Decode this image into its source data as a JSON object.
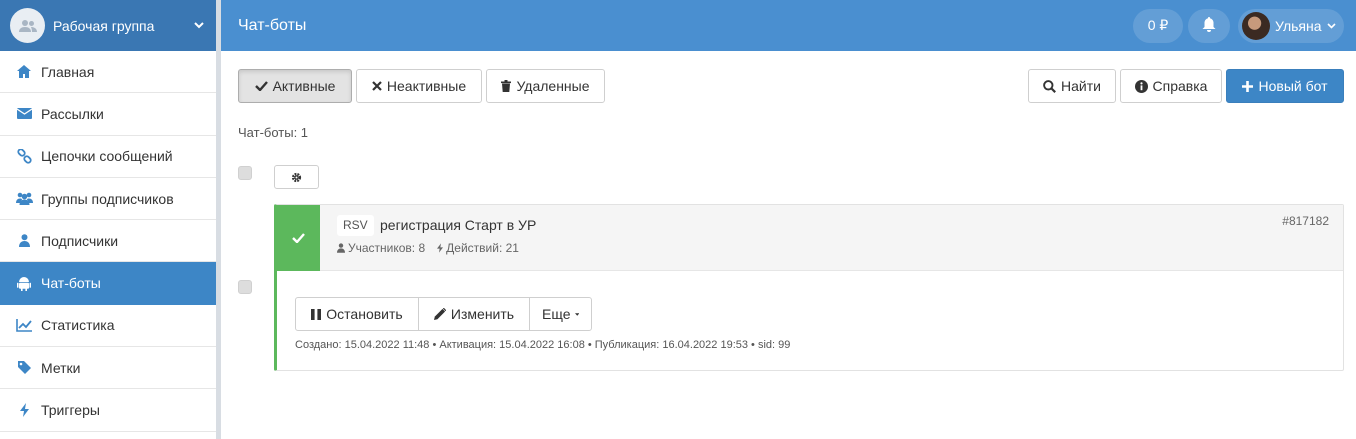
{
  "sidebar": {
    "workgroup": "Рабочая группа",
    "items": [
      {
        "label": "Главная",
        "icon": "home-icon"
      },
      {
        "label": "Рассылки",
        "icon": "envelope-icon"
      },
      {
        "label": "Цепочки сообщений",
        "icon": "link-icon"
      },
      {
        "label": "Группы подписчиков",
        "icon": "users-icon"
      },
      {
        "label": "Подписчики",
        "icon": "user-icon"
      },
      {
        "label": "Чат-боты",
        "icon": "android-icon",
        "active": true
      },
      {
        "label": "Статистика",
        "icon": "line-chart-icon"
      },
      {
        "label": "Метки",
        "icon": "tag-icon"
      },
      {
        "label": "Триггеры",
        "icon": "bolt-icon"
      }
    ]
  },
  "topbar": {
    "title": "Чат-боты",
    "balance": "0 ₽",
    "user": "Ульяна"
  },
  "filters": {
    "active": "Активные",
    "inactive": "Неактивные",
    "deleted": "Удаленные"
  },
  "toolbar": {
    "search": "Найти",
    "help": "Справка",
    "new_bot": "Новый бот"
  },
  "list": {
    "count": "Чат-боты: 1"
  },
  "bot": {
    "tag": "RSV",
    "name": "регистрация Старт в УР",
    "participants": "Участников: 8",
    "actions": "Действий: 21",
    "id": "#817182",
    "stop": "Остановить",
    "edit": "Изменить",
    "more": "Еще",
    "dates": "Создано: 15.04.2022 11:48 • Активация: 15.04.2022 16:08 • Публикация: 16.04.2022 19:53 • sid: 99"
  },
  "colors": {
    "topbar": "#4a8fd0",
    "workgroup": "#3a77b3",
    "active_nav": "#3d86c6",
    "primary": "#3d86c6",
    "success": "#5cb85c"
  }
}
